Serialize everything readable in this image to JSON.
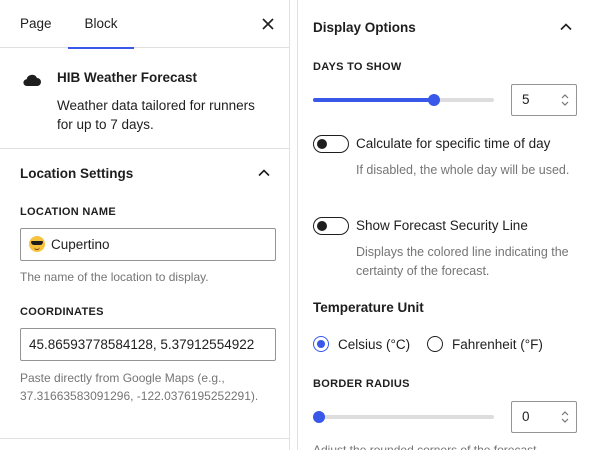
{
  "tabs": {
    "page": "Page",
    "block": "Block"
  },
  "block": {
    "title": "HIB Weather Forecast",
    "description": "Weather data tailored for runners for up to 7 days."
  },
  "location_settings": {
    "title": "Location Settings",
    "location_name": {
      "label": "LOCATION NAME",
      "value": "Cupertino",
      "help": "The name of the location to display."
    },
    "coordinates": {
      "label": "COORDINATES",
      "value": "45.86593778584128, 5.37912554922",
      "help": "Paste directly from Google Maps (e.g., 37.31663583091296, -122.0376195252291)."
    }
  },
  "display_options": {
    "title": "Display Options",
    "days_to_show": {
      "label": "DAYS TO SHOW",
      "value": "5",
      "slider_fraction": 0.67
    },
    "specific_time": {
      "label": "Calculate for specific time of day",
      "help": "If disabled, the whole day will be used.",
      "enabled": false
    },
    "security_line": {
      "label": "Show Forecast Security Line",
      "help": "Displays the colored line indicating the certainty of the forecast.",
      "enabled": false
    },
    "temperature_unit": {
      "title": "Temperature Unit",
      "options": [
        "Celsius (°C)",
        "Fahrenheit (°F)"
      ],
      "selected": "Celsius (°C)"
    },
    "border_radius": {
      "label": "BORDER RADIUS",
      "value": "0",
      "slider_fraction": 0.0,
      "help_partial": "Adjust the rounded corners of the forecast"
    }
  },
  "colors": {
    "accent": "#3858e9",
    "text": "#1e1e1e",
    "muted": "#757575",
    "border": "#e0e0e0"
  }
}
